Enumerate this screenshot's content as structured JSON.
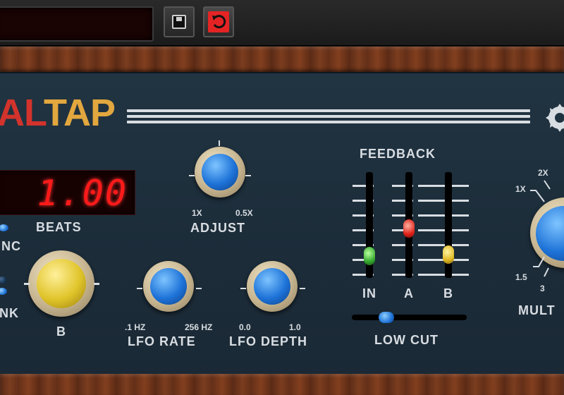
{
  "toolbar": {
    "preset_display": "",
    "save_icon": "save-icon",
    "reset_icon": "reset-icon",
    "reset_color": "#e42424"
  },
  "logo": {
    "part_red": "AL",
    "part_gold": "TAP",
    "brand_icon": "gear-icon"
  },
  "colors": {
    "panel": "#1f3240",
    "led_red": "#ff1a1a",
    "knob_blue": "#1e73d8",
    "knob_yellow": "#e0c42a"
  },
  "delay": {
    "display_value": "1.00",
    "beats_label": "BEATS",
    "sync_label": "NC",
    "link_label": "NK",
    "b_knob_label": "B"
  },
  "adjust": {
    "label": "ADJUST",
    "min_label": "1X",
    "max_label": "0.5X"
  },
  "lfo_rate": {
    "label": "LFO RATE",
    "min_label": ".1 HZ",
    "max_label": "256 HZ"
  },
  "lfo_depth": {
    "label": "LFO DEPTH",
    "min_label": "0.0",
    "max_label": "1.0"
  },
  "feedback": {
    "title": "FEEDBACK",
    "sliders": [
      {
        "label": "IN",
        "color": "green"
      },
      {
        "label": "A",
        "color": "red"
      },
      {
        "label": "B",
        "color": "yellow"
      }
    ]
  },
  "low_cut": {
    "label": "LOW CUT"
  },
  "multiply": {
    "label": "MULT",
    "marks": [
      "1X",
      "2X",
      "1.5",
      "3"
    ]
  }
}
